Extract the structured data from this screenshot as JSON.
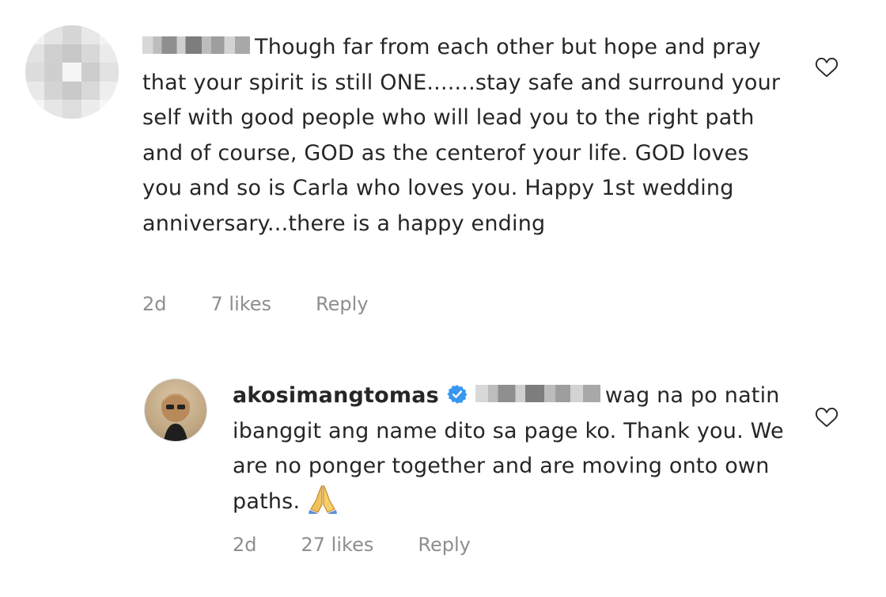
{
  "comments": [
    {
      "username": "",
      "text_after_name": "Though far from each other but hope and pray that your spirit is still ONE.......stay safe and surround your self with good people who will lead you to the right path and of course, GOD as the centerof your life.  GOD loves you and so is Carla who loves you.  Happy 1st wedding anniversary...there is a happy ending",
      "time": "2d",
      "likes": "7 likes",
      "reply_label": "Reply"
    },
    {
      "username": "akosimangtomas",
      "verified": true,
      "text_after_name": "wag na po natin ibanggit ang name dito sa page ko. Thank you. We are no ponger together and are moving onto own paths.",
      "emoji": "folded-hands-emoji",
      "time": "2d",
      "likes": "27 likes",
      "reply_label": "Reply"
    }
  ],
  "colors": {
    "text": "#262626",
    "meta": "#8e8e8e",
    "verified_badge": "#3897f0"
  },
  "icons": [
    "heart-icon",
    "verified-badge-icon",
    "folded-hands-emoji"
  ]
}
